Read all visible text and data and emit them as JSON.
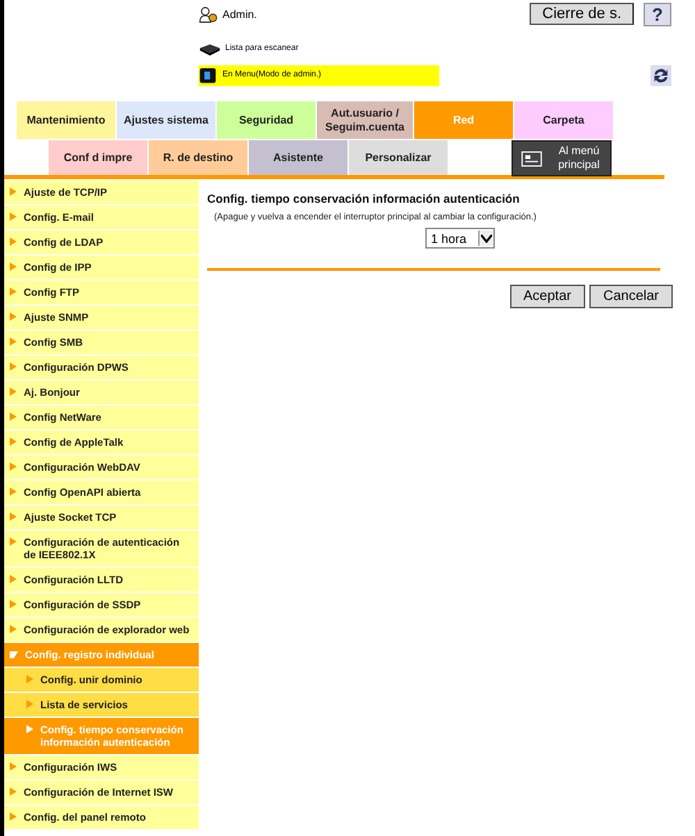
{
  "header": {
    "user": "Admin.",
    "logout_button": "Cierre de s.",
    "help_button": "?",
    "status_ready": "Lista para escanear",
    "status_mode": "En Menu(Modo de admin.)"
  },
  "tabs_row1": [
    {
      "label": "Mantenimiento",
      "selected": false,
      "color": "#fff59a"
    },
    {
      "label": "Ajustes sistema",
      "selected": false,
      "color": "#dce8fa"
    },
    {
      "label": "Seguridad",
      "selected": false,
      "color": "#ccff99"
    },
    {
      "label": "Aut.usuario / Seguim.cuenta",
      "selected": false,
      "color": "#d8bcb4"
    },
    {
      "label": "Red",
      "selected": true,
      "color": "#ff9900"
    },
    {
      "label": "Carpeta",
      "selected": false,
      "color": "#ffccff"
    }
  ],
  "tabs_row2": [
    {
      "label": "Conf d impre",
      "selected": false,
      "color": "#ffcccc"
    },
    {
      "label": "R. de destino",
      "selected": false,
      "color": "#ffcc99"
    },
    {
      "label": "Asistente",
      "selected": false,
      "color": "#c4c0d0"
    },
    {
      "label": "Personalizar",
      "selected": false,
      "color": "#dddddd"
    }
  ],
  "main_menu_button": "Al menú principal",
  "sidebar": {
    "items": [
      {
        "label": "Ajuste de TCP/IP",
        "selected": false
      },
      {
        "label": "Config. E-mail",
        "selected": false
      },
      {
        "label": "Config de LDAP",
        "selected": false
      },
      {
        "label": "Config de IPP",
        "selected": false
      },
      {
        "label": "Config FTP",
        "selected": false
      },
      {
        "label": "Ajuste SNMP",
        "selected": false
      },
      {
        "label": "Config SMB",
        "selected": false
      },
      {
        "label": "Configuración DPWS",
        "selected": false
      },
      {
        "label": "Aj. Bonjour",
        "selected": false
      },
      {
        "label": "Config NetWare",
        "selected": false
      },
      {
        "label": "Config de AppleTalk",
        "selected": false
      },
      {
        "label": "Configuración WebDAV",
        "selected": false
      },
      {
        "label": "Config OpenAPI abierta",
        "selected": false
      },
      {
        "label": "Ajuste Socket TCP",
        "selected": false
      },
      {
        "label": "Configuración de autenticación de IEEE802.1X",
        "selected": false
      },
      {
        "label": "Configuración LLTD",
        "selected": false
      },
      {
        "label": "Configuración de SSDP",
        "selected": false
      },
      {
        "label": "Configuración de explorador web",
        "selected": false
      },
      {
        "label": "Config. registro individual",
        "selected": false,
        "expanded": true,
        "children": [
          {
            "label": "Config. unir dominio",
            "selected": false
          },
          {
            "label": "Lista de servicios",
            "selected": false
          },
          {
            "label": "Config. tiempo conservación información autenticación",
            "selected": true
          }
        ]
      },
      {
        "label": "Configuración IWS",
        "selected": false
      },
      {
        "label": "Configuración de Internet ISW",
        "selected": false
      },
      {
        "label": "Config. del panel remoto",
        "selected": false
      }
    ]
  },
  "content": {
    "title": "Config. tiempo conservación información autenticación",
    "note": "(Apague y vuelva a encender el interruptor principal al cambiar la configuración.)",
    "select_value": "1 hora",
    "buttons": [
      "Aceptar",
      "Cancelar"
    ]
  }
}
